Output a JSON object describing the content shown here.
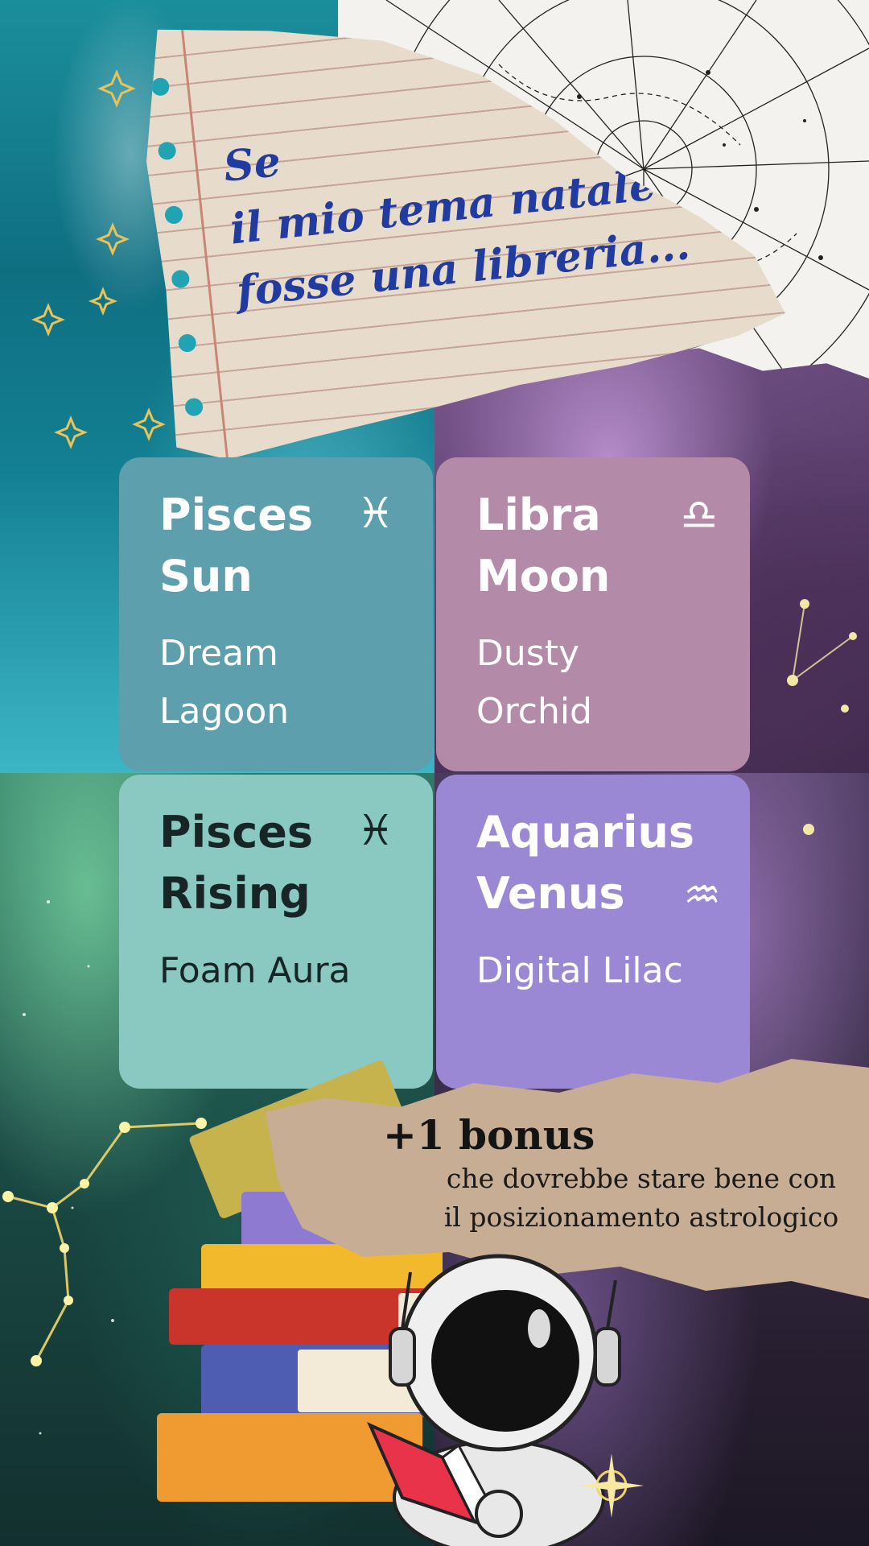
{
  "note": {
    "lines": [
      "Se",
      "il mio tema natale",
      "fosse una libreria..."
    ]
  },
  "tiles": [
    {
      "title_line1": "Pisces",
      "title_line2": "Sun",
      "sub_line1": "Dream",
      "sub_line2": "Lagoon",
      "glyph": "♓︎",
      "color": "#5e9fad",
      "icon": "pisces-icon"
    },
    {
      "title_line1": "Libra",
      "title_line2": "Moon",
      "sub_line1": "Dusty",
      "sub_line2": "Orchid",
      "glyph": "♎︎",
      "color": "#b48aa9",
      "icon": "libra-icon"
    },
    {
      "title_line1": "Pisces",
      "title_line2": "Rising",
      "sub_line1": "Foam Aura",
      "sub_line2": "",
      "glyph": "♓︎",
      "color": "#8ac8c2",
      "icon": "pisces-icon"
    },
    {
      "title_line1": "Aquarius",
      "title_line2": "Venus",
      "sub_line1": "Digital Lilac",
      "sub_line2": "",
      "glyph": "♒︎",
      "color": "#9b88d4",
      "icon": "aquarius-icon"
    }
  ],
  "bonus": {
    "title": "+1 bonus",
    "line1": "che dovrebbe stare bene con",
    "line2": "il posizionamento astrologico"
  }
}
